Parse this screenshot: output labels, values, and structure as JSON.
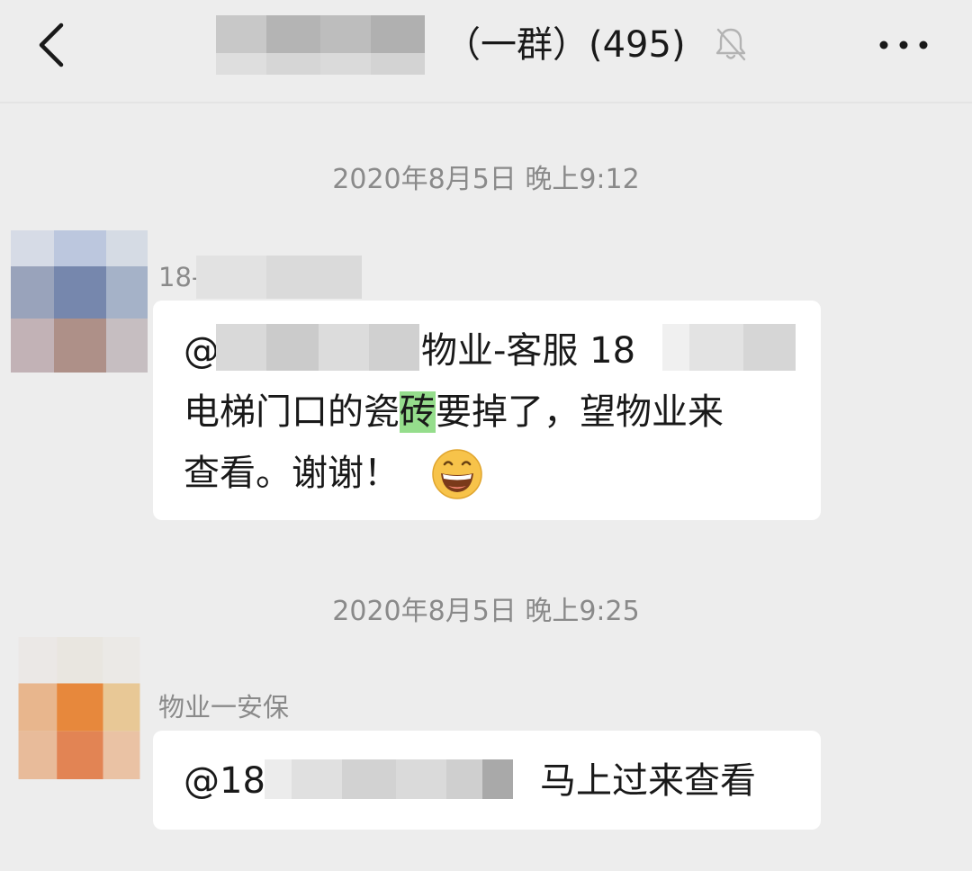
{
  "header": {
    "back_icon": "chevron-left-icon",
    "title_suffix": "（一群）(495)",
    "mute_icon": "bell-off-icon",
    "more_icon": "more-dots-icon"
  },
  "messages": [
    {
      "timestamp": "2020年8月5日 晚上9:12",
      "sender_name": "18-",
      "line1_prefix": "@",
      "line1_mid": "物业-客服 18",
      "line2_before": "电梯门口的瓷",
      "line2_highlight": "砖",
      "line2_after": "要掉了，望物业来",
      "line3": "查看。谢谢！",
      "emoji": "grinning-face-icon"
    },
    {
      "timestamp": "2020年8月5日 晚上9:25",
      "sender_name": "物业一安保",
      "line1_prefix": "@18",
      "line1_after": "马上过来查看"
    }
  ],
  "colors": {
    "background": "#ededed",
    "bubble": "#ffffff",
    "highlight": "#95dd8c",
    "timestamp_text": "#8a8a8a"
  }
}
